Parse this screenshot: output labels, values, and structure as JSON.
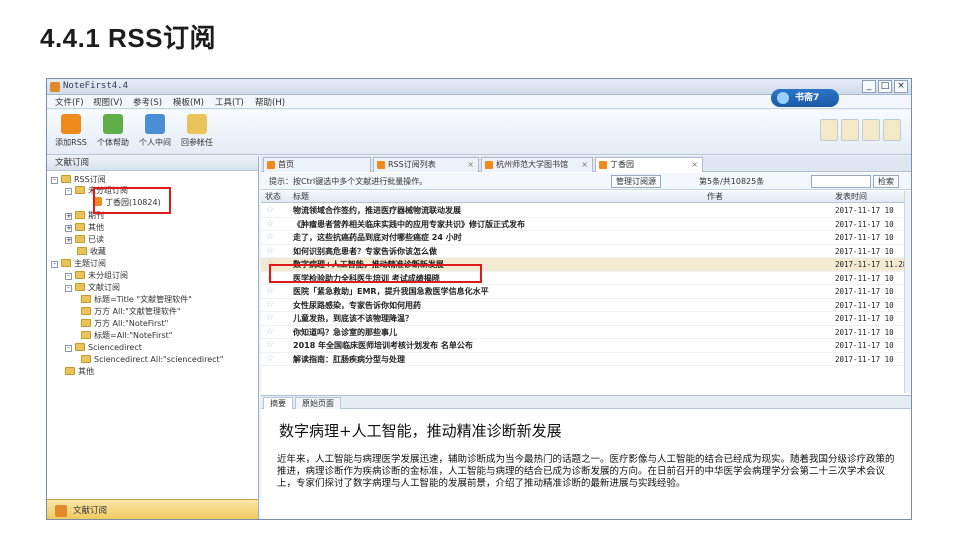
{
  "slide": {
    "title": "4.4.1  RSS订阅"
  },
  "window": {
    "title": "NoteFirst4.4",
    "brand": "书斋7",
    "controls": {
      "minimize": "_",
      "maximize": "□",
      "close": "×"
    }
  },
  "menu": [
    "文件(F)",
    "视图(V)",
    "参考(S)",
    "模板(M)",
    "工具(T)",
    "帮助(H)"
  ],
  "toolbar": {
    "items": [
      "添加RSS",
      "个体帮助",
      "个人中间",
      "回参帐任"
    ]
  },
  "left_panel": {
    "header": "文献订阅",
    "tree": [
      {
        "label": "RSS订阅",
        "level": 0,
        "kind": "folder"
      },
      {
        "label": "未分组订阅",
        "level": 1,
        "kind": "folder"
      },
      {
        "label": "丁香园(10824)",
        "level": 2,
        "kind": "rss"
      },
      {
        "label": "期刊",
        "level": 1,
        "kind": "folder"
      },
      {
        "label": "其他",
        "level": 1,
        "kind": "folder"
      },
      {
        "label": "已读",
        "level": 1,
        "kind": "folder"
      },
      {
        "label": "收藏",
        "level": 1,
        "kind": "folder"
      },
      {
        "label": "主题订阅",
        "level": 0,
        "kind": "folder"
      },
      {
        "label": "未分组订阅",
        "level": 1,
        "kind": "folder"
      },
      {
        "label": "文献订阅",
        "level": 1,
        "kind": "folder"
      },
      {
        "label": "标题=Title \"文献管理软件\"",
        "level": 2,
        "kind": "folder"
      },
      {
        "label": "万方 All:\"文献管理软件\"",
        "level": 2,
        "kind": "folder"
      },
      {
        "label": "万方 All:\"NoteFirst\"",
        "level": 2,
        "kind": "folder"
      },
      {
        "label": "标题=All:\"NoteFirst\"",
        "level": 2,
        "kind": "folder"
      },
      {
        "label": "Sciencedirect",
        "level": 1,
        "kind": "folder"
      },
      {
        "label": "Sciencedirect All:\"sciencedirect\"",
        "level": 2,
        "kind": "folder"
      },
      {
        "label": "其他",
        "level": 1,
        "kind": "folder"
      }
    ],
    "footer": "文献订阅"
  },
  "tabs": [
    {
      "label": "首页",
      "active": false
    },
    {
      "label": "RSS订阅列表",
      "active": false
    },
    {
      "label": "杭州师范大学图书馆",
      "active": false
    },
    {
      "label": "丁香园",
      "active": true
    }
  ],
  "filter_bar": {
    "hint": "提示：按Ctrl键选中多个文献进行批量操作。",
    "button_manage": "管理订阅源",
    "count": "第5条/共10825条",
    "search_button": "检索"
  },
  "grid": {
    "columns": [
      "状态",
      "标题",
      "作者",
      "发表时间"
    ],
    "rows": [
      {
        "title": "物流领域合作签约，推进医疗器械物流联动发展",
        "date": "2017-11-17 10"
      },
      {
        "title": "《肿瘤患者营养相关临床实践中的应用专家共识》修订版正式发布",
        "date": "2017-11-17 10"
      },
      {
        "title": "走了，这些抗癌药品到底对付哪些癌症 24 小时",
        "date": "2017-11-17 10"
      },
      {
        "title": "如何识别高危患者？专家告诉你该怎么做",
        "date": "2017-11-17 10"
      },
      {
        "title": "数字病理+人工智能，推动精准诊断新发展",
        "date": "2017-11-17 11.28",
        "selected": true
      },
      {
        "title": "医学检验助力全科医生培训 考试成绩揭晓",
        "date": "2017-11-17 10"
      },
      {
        "title": "医院「紧急救助」EMR，提升我国急救医学信息化水平",
        "date": "2017-11-17 10"
      },
      {
        "title": "女性尿路感染，专家告诉你如何用药",
        "date": "2017-11-17 10"
      },
      {
        "title": "儿童发热，到底该不该物理降温？",
        "date": "2017-11-17 10"
      },
      {
        "title": "你知道吗？急诊室的那些事儿",
        "date": "2017-11-17 10"
      },
      {
        "title": "2018 年全国临床医师培训考核计划发布 名单公布",
        "date": "2017-11-17 10"
      },
      {
        "title": "解读指南：肛肠疾病分型与处理",
        "date": "2017-11-17 10"
      }
    ]
  },
  "detail": {
    "tabs": [
      "摘要",
      "原始页面"
    ],
    "title": "数字病理+人工智能，推动精准诊断新发展",
    "body": "近年来，人工智能与病理医学发展迅速，辅助诊断成为当今最热门的话题之一。医疗影像与人工智能的结合已经成为现实。随着我国分级诊疗政策的推进，病理诊断作为疾病诊断的金标准，人工智能与病理的结合已成为诊断发展的方向。在日前召开的中华医学会病理学分会第二十三次学术会议上，专家们探讨了数字病理与人工智能的发展前景，介绍了推动精准诊断的最新进展与实践经验。"
  }
}
